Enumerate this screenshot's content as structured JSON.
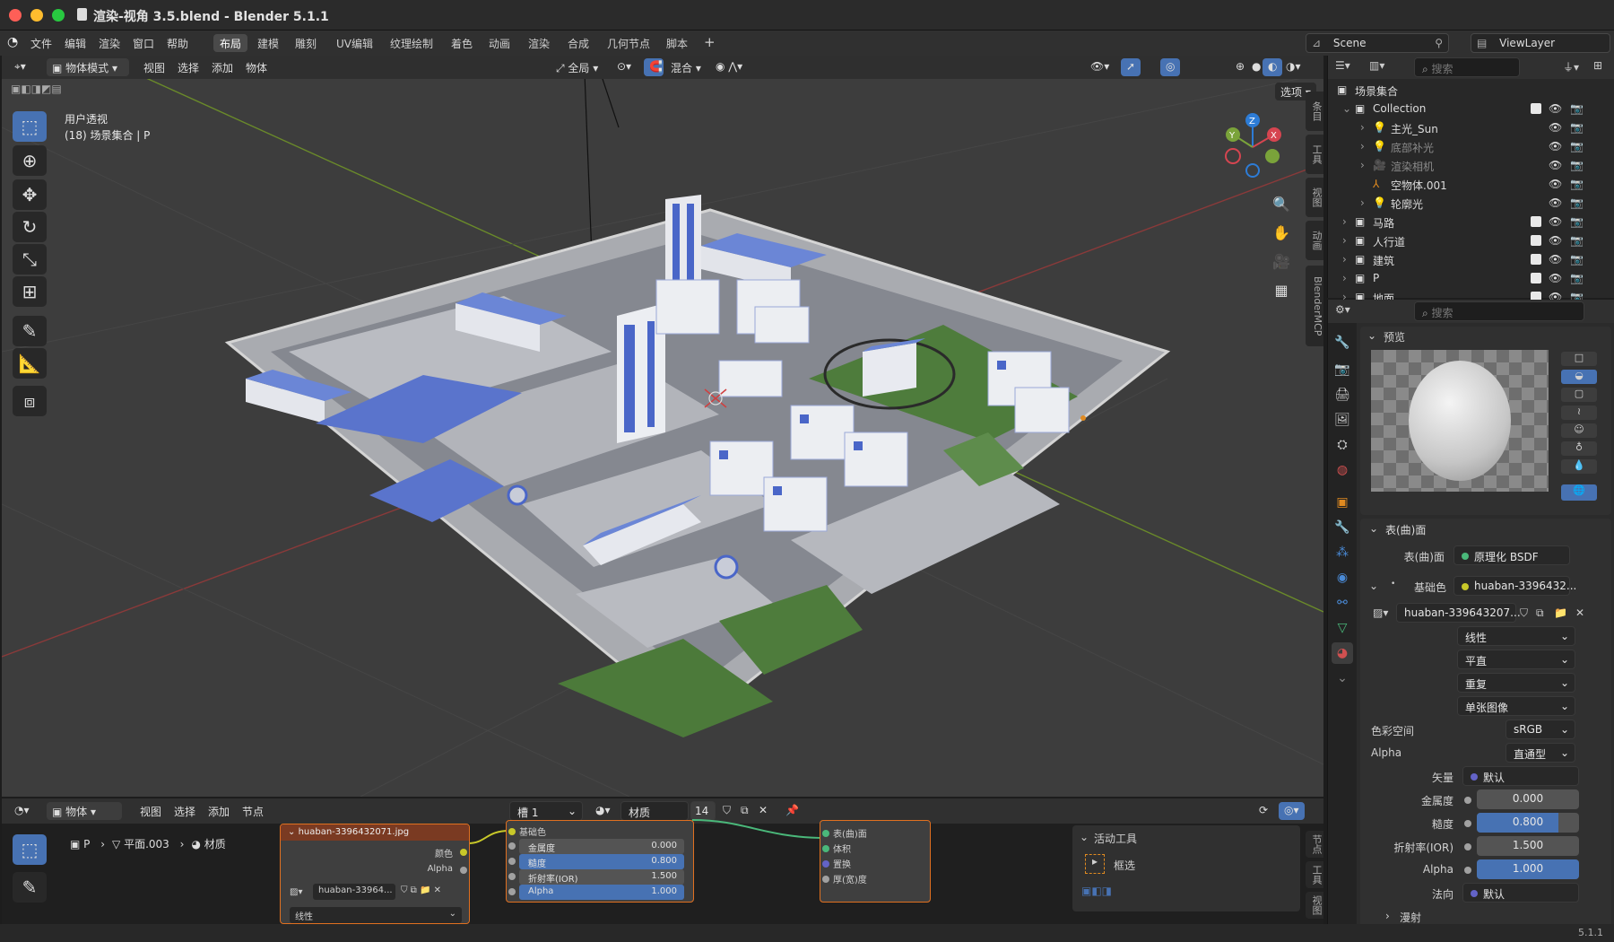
{
  "window": {
    "title": "渲染-视角 3.5.blend - Blender 5.1.1",
    "traffic_colors": [
      "#fe5f57",
      "#febc2e",
      "#28c840"
    ]
  },
  "menu": {
    "items": [
      "文件",
      "编辑",
      "渲染",
      "窗口",
      "帮助"
    ],
    "workspaces": [
      "布局",
      "建模",
      "雕刻",
      "UV编辑",
      "纹理绘制",
      "着色",
      "动画",
      "渲染",
      "合成",
      "几何节点",
      "脚本"
    ],
    "active_workspace": "布局",
    "add": "+",
    "scene": "Scene",
    "viewlayer": "ViewLayer"
  },
  "viewport": {
    "mode": "物体模式",
    "menus": [
      "视图",
      "选择",
      "添加",
      "物体"
    ],
    "transform_orientation": "全局",
    "snap_mode": "混合",
    "options": "选项",
    "view_label": "用户透视",
    "collection_info": "(18) 场景集合 | P",
    "side_tabs": [
      "条目",
      "工具",
      "视图",
      "动画",
      "BlenderMCP"
    ],
    "gizmo": {
      "x": "X",
      "y": "Y",
      "z": "Z"
    }
  },
  "outliner": {
    "search_placeholder": "搜索",
    "root": "场景集合",
    "rows": [
      {
        "label": "Collection",
        "level": 1,
        "type": "collection"
      },
      {
        "label": "主光_Sun",
        "level": 2,
        "type": "light"
      },
      {
        "label": "底部补光",
        "level": 2,
        "type": "light",
        "dim": true
      },
      {
        "label": "渲染相机",
        "level": 2,
        "type": "camera",
        "dim": true
      },
      {
        "label": "空物体.001",
        "level": 2,
        "type": "empty"
      },
      {
        "label": "轮廓光",
        "level": 2,
        "type": "light"
      },
      {
        "label": "马路",
        "level": 1,
        "type": "collection"
      },
      {
        "label": "人行道",
        "level": 1,
        "type": "collection"
      },
      {
        "label": "建筑",
        "level": 1,
        "type": "collection"
      },
      {
        "label": "P",
        "level": 1,
        "type": "collection"
      },
      {
        "label": "地面",
        "level": 1,
        "type": "collection"
      }
    ]
  },
  "properties": {
    "search_placeholder": "搜索",
    "preview_title": "预览",
    "surface_title": "表(曲)面",
    "surface_label": "表(曲)面",
    "surface_value": "原理化 BSDF",
    "base_color_label": "基础色",
    "base_color_value": "huaban-3396432...",
    "image_name": "huaban-339643207...",
    "interpolation": "线性",
    "projection": "平直",
    "extension": "重复",
    "source": "单张图像",
    "colorspace_label": "色彩空间",
    "colorspace": "sRGB",
    "alpha_label": "Alpha",
    "alpha_mode": "直通型",
    "vector_label": "矢量",
    "vector_value": "默认",
    "metallic_label": "金属度",
    "metallic": "0.000",
    "roughness_label": "糙度",
    "roughness": "0.800",
    "ior_label": "折射率(IOR)",
    "ior": "1.500",
    "alpha2_label": "Alpha",
    "alpha_value": "1.000",
    "normal_label": "法向",
    "normal_value": "默认",
    "subsurface_label": "漫射",
    "roughness_fraction": 0.8,
    "alpha_fraction": 1.0
  },
  "node_editor": {
    "type": "物体",
    "menus": [
      "视图",
      "选择",
      "添加",
      "节点"
    ],
    "slot": "槽 1",
    "material_label": "材质",
    "users": "14",
    "breadcrumb": [
      "P",
      "平面.003",
      "材质"
    ],
    "image_node": {
      "title": "huaban-3396432071.jpg",
      "outputs": [
        "颜色",
        "Alpha"
      ],
      "image": "huaban-33964...",
      "interp": "线性"
    },
    "bsdf_node": {
      "title": "基础色",
      "rows": [
        {
          "label": "金属度",
          "value": "0.000"
        },
        {
          "label": "糙度",
          "value": "0.800"
        },
        {
          "label": "折射率(IOR)",
          "value": "1.500"
        },
        {
          "label": "Alpha",
          "value": "1.000"
        }
      ]
    },
    "output_node": {
      "rows": [
        "表(曲)面",
        "体积",
        "置换",
        "厚(宽)度"
      ]
    },
    "active_tool": {
      "title": "活动工具",
      "tool": "框选"
    },
    "side_tabs": [
      "节点",
      "工具",
      "视图"
    ]
  },
  "status": {
    "version": "5.1.1"
  }
}
